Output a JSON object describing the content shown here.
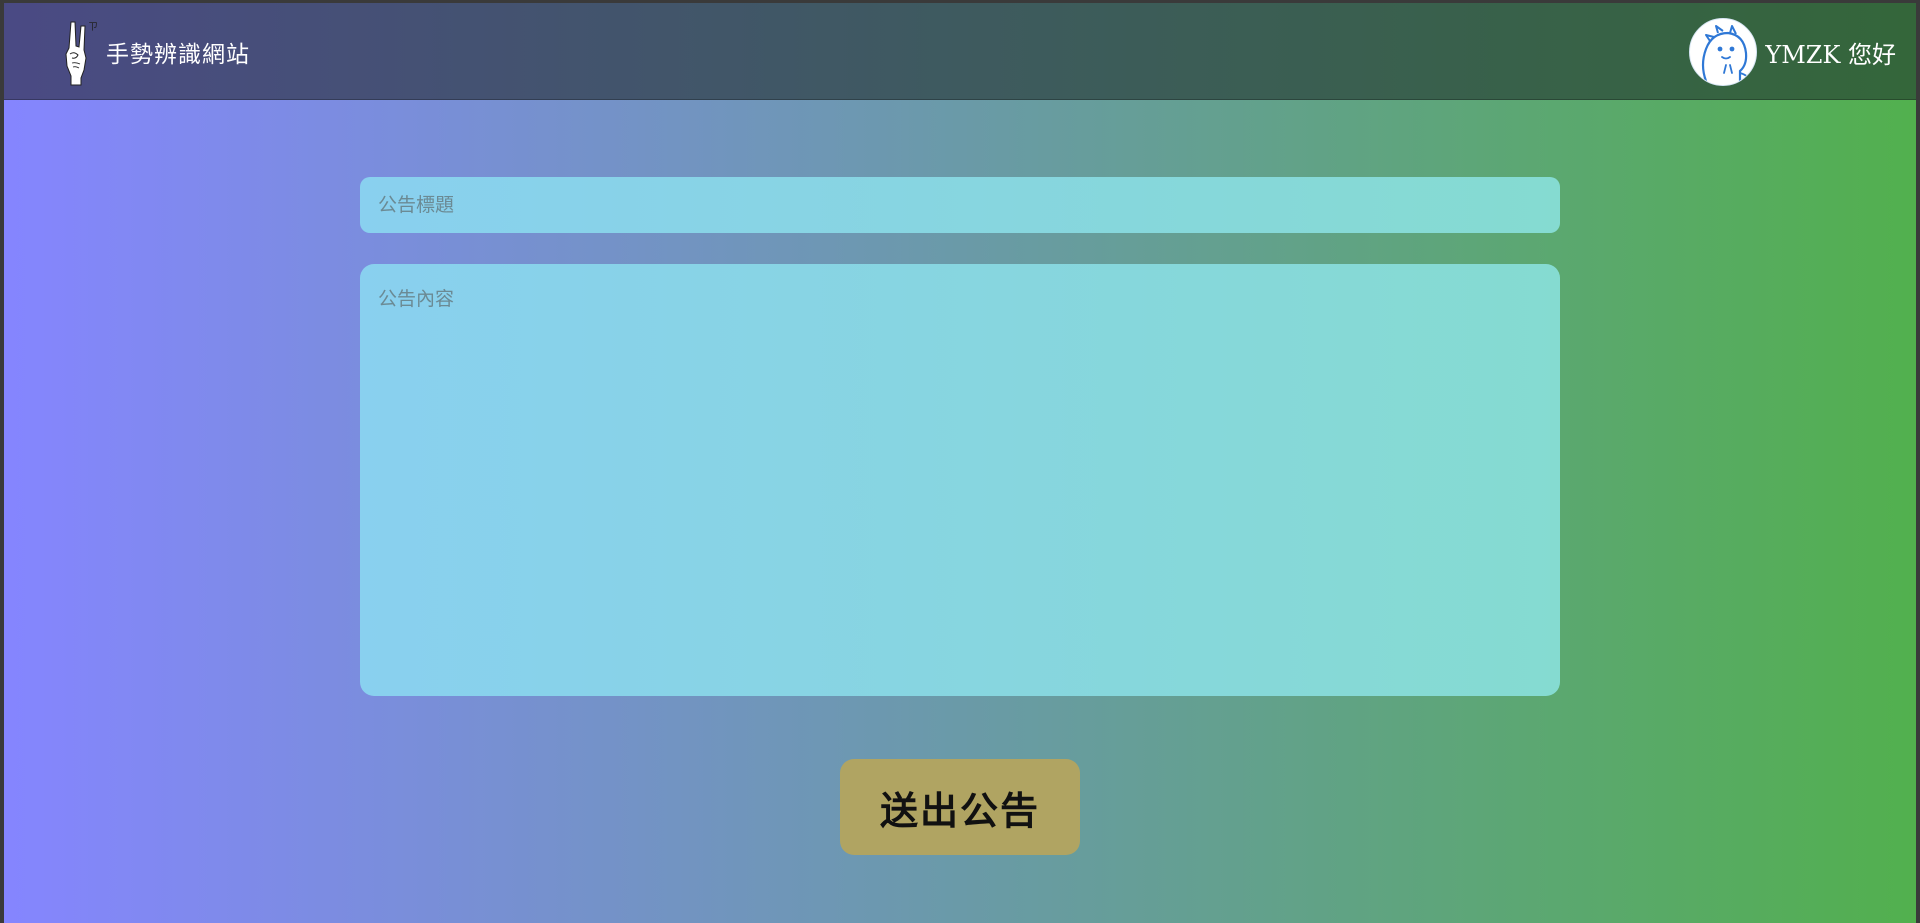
{
  "navbar": {
    "site_name": "手勢辨識網站",
    "logo_icon": "rock-hand-gesture-icon",
    "user": {
      "avatar_icon": "dinosaur-avatar-icon",
      "greeting": "YMZK 您好"
    }
  },
  "form": {
    "title_placeholder": "公告標題",
    "title_value": "",
    "content_placeholder": "公告內容",
    "content_value": "",
    "submit_label": "送出公告"
  },
  "colors": {
    "background_left": "#8585ff",
    "background_right": "#52b04e",
    "input_fill": "#89d0ef",
    "button_fill": "#b0a462"
  }
}
